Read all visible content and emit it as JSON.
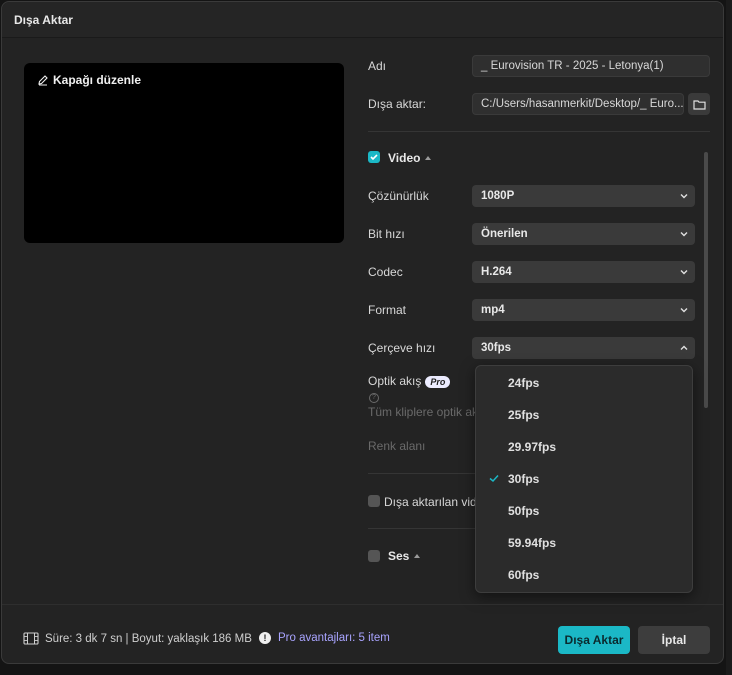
{
  "window": {
    "title": "Dışa Aktar"
  },
  "preview": {
    "edit_cover_label": "Kapağı düzenle"
  },
  "fields": {
    "name_label": "Adı",
    "name_value": "_ Eurovision TR - 2025 - Letonya(1)",
    "export_to_label": "Dışa aktar:",
    "export_to_value": "C:/Users/hasanmerkit/Desktop/_ Euro..."
  },
  "video": {
    "section_label": "Video",
    "checked": true,
    "resolution_label": "Çözünürlük",
    "resolution_value": "1080P",
    "bitrate_label": "Bit hızı",
    "bitrate_value": "Önerilen",
    "codec_label": "Codec",
    "codec_value": "H.264",
    "format_label": "Format",
    "format_value": "mp4",
    "framerate_label": "Çerçeve hızı",
    "framerate_value": "30fps",
    "optical_flow_label": "Optik akış",
    "pro_badge": "Pro",
    "optical_flow_desc": "Tüm kliplere optik ak",
    "color_space_label": "Renk alanı"
  },
  "framerate_options": [
    {
      "label": "24fps",
      "selected": false
    },
    {
      "label": "25fps",
      "selected": false
    },
    {
      "label": "29.97fps",
      "selected": false
    },
    {
      "label": "30fps",
      "selected": true
    },
    {
      "label": "50fps",
      "selected": false
    },
    {
      "label": "59.94fps",
      "selected": false
    },
    {
      "label": "60fps",
      "selected": false
    }
  ],
  "exported_video": {
    "label": "Dışa aktarılan vide",
    "checked": false
  },
  "audio": {
    "section_label": "Ses",
    "checked": false
  },
  "footer": {
    "info": "Süre: 3 dk 7 sn | Boyut: yaklaşık 186 MB",
    "pro_benefits": "Pro avantajları: 5 item",
    "export_button": "Dışa Aktar",
    "cancel_button": "İptal"
  },
  "colors": {
    "accent": "#1bb8c6",
    "pro_text": "#a9a4ff",
    "background": "#232323"
  }
}
